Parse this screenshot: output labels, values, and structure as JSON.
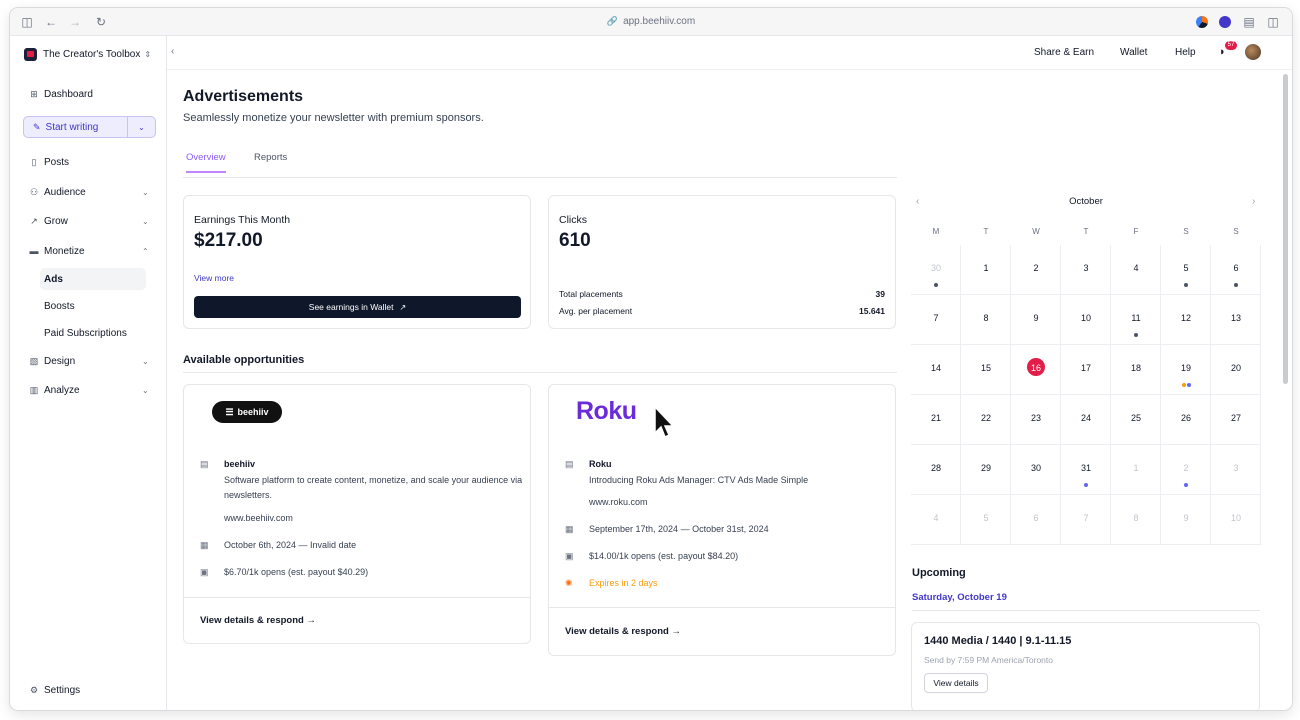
{
  "browser": {
    "url": "app.beehiiv.com"
  },
  "sidebar": {
    "workspace": "The Creator's Toolbox",
    "start_writing": "Start writing",
    "items": [
      {
        "label": "Dashboard",
        "icon": "grid-icon"
      },
      {
        "label": "Posts",
        "icon": "document-icon"
      },
      {
        "label": "Audience",
        "icon": "audience-icon"
      },
      {
        "label": "Grow",
        "icon": "trend-up-icon"
      },
      {
        "label": "Monetize",
        "icon": "monetize-icon"
      },
      {
        "label": "Design",
        "icon": "design-icon"
      },
      {
        "label": "Analyze",
        "icon": "bar-chart-icon"
      }
    ],
    "monetize_sub": [
      "Ads",
      "Boosts",
      "Paid Subscriptions"
    ],
    "settings": "Settings"
  },
  "topbar": {
    "share_earn": "Share & Earn",
    "wallet": "Wallet",
    "help": "Help",
    "notifications": "57"
  },
  "page": {
    "title": "Advertisements",
    "subtitle": "Seamlessly monetize your newsletter with premium sponsors.",
    "tabs": [
      "Overview",
      "Reports"
    ]
  },
  "earnings": {
    "label": "Earnings This Month",
    "value": "$217.00",
    "view_more": "View more",
    "button": "See earnings in Wallet"
  },
  "clicks": {
    "label": "Clicks",
    "value": "610",
    "rows": [
      {
        "label": "Total placements",
        "value": "39"
      },
      {
        "label": "Avg. per placement",
        "value": "15.641"
      }
    ]
  },
  "opportunities": {
    "title": "Available opportunities",
    "items": [
      {
        "logo": "beehiiv",
        "name": "beehiiv",
        "description": "Software platform to create content, monetize, and scale your audience via newsletters.",
        "url": "www.beehiiv.com",
        "dates": "October 6th, 2024 — Invalid date",
        "payout": "$6.70/1k opens (est. payout $40.29)",
        "link": "View details & respond →"
      },
      {
        "logo": "Roku",
        "name": "Roku",
        "description": "Introducing Roku Ads Manager: CTV Ads Made Simple",
        "url": "www.roku.com",
        "dates": "September 17th, 2024 — October 31st, 2024",
        "payout": "$14.00/1k opens (est. payout $84.20)",
        "expires": "Expires in 2 days",
        "link": "View details & respond →"
      }
    ]
  },
  "calendar": {
    "month": "October",
    "weekdays": [
      "M",
      "T",
      "W",
      "T",
      "F",
      "S",
      "S"
    ],
    "days": [
      {
        "n": "30",
        "muted": true,
        "dots": [
          "#4b5563"
        ]
      },
      {
        "n": "1"
      },
      {
        "n": "2"
      },
      {
        "n": "3"
      },
      {
        "n": "4"
      },
      {
        "n": "5",
        "dots": [
          "#4b5563"
        ]
      },
      {
        "n": "6",
        "dots": [
          "#4b5563"
        ]
      },
      {
        "n": "7"
      },
      {
        "n": "8"
      },
      {
        "n": "9"
      },
      {
        "n": "10"
      },
      {
        "n": "11",
        "dots": [
          "#4b5563"
        ]
      },
      {
        "n": "12"
      },
      {
        "n": "13"
      },
      {
        "n": "14"
      },
      {
        "n": "15"
      },
      {
        "n": "16",
        "today": true
      },
      {
        "n": "17"
      },
      {
        "n": "18"
      },
      {
        "n": "19",
        "dots": [
          "#f59e0b",
          "#6366f1"
        ]
      },
      {
        "n": "20"
      },
      {
        "n": "21"
      },
      {
        "n": "22"
      },
      {
        "n": "23"
      },
      {
        "n": "24"
      },
      {
        "n": "25"
      },
      {
        "n": "26"
      },
      {
        "n": "27"
      },
      {
        "n": "28"
      },
      {
        "n": "29"
      },
      {
        "n": "30"
      },
      {
        "n": "31",
        "dots": [
          "#6366f1"
        ]
      },
      {
        "n": "1",
        "muted": true
      },
      {
        "n": "2",
        "muted": true,
        "dots": [
          "#6366f1"
        ]
      },
      {
        "n": "3",
        "muted": true
      },
      {
        "n": "4",
        "muted": true
      },
      {
        "n": "5",
        "muted": true
      },
      {
        "n": "6",
        "muted": true
      },
      {
        "n": "7",
        "muted": true
      },
      {
        "n": "8",
        "muted": true
      },
      {
        "n": "9",
        "muted": true
      },
      {
        "n": "10",
        "muted": true
      }
    ]
  },
  "upcoming": {
    "title": "Upcoming",
    "date": "Saturday, October 19",
    "item": {
      "name": "1440 Media / 1440 | 9.1-11.15",
      "send": "Send by 7:59 PM America/Toronto",
      "button": "View details"
    }
  },
  "colors": {
    "accent": "#3f37c9",
    "today": "#e11d48",
    "roku": "#6c2bd9",
    "expires": "#f59e0b"
  }
}
